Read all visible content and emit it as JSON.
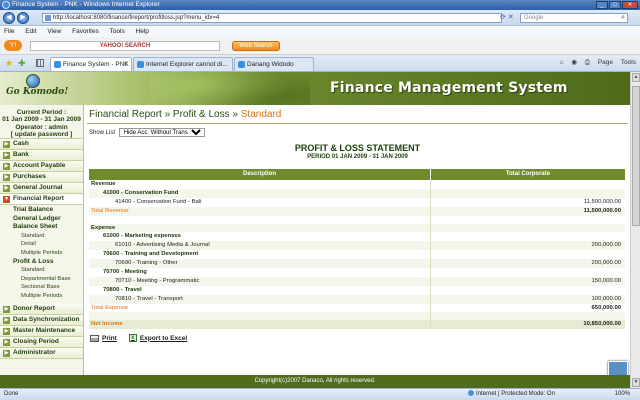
{
  "browser": {
    "window_title": "Finance System - PNK - Windows Internet Explorer",
    "url": "http://localhost:8080/finance/fireport/profitloss.jsp?menu_idx=4",
    "search_placeholder": "Google",
    "menu": [
      "File",
      "Edit",
      "View",
      "Favorites",
      "Tools",
      "Help"
    ],
    "yahoo_search_label": "YAHOO! SEARCH",
    "web_search_button": "Web Search",
    "tabs": [
      {
        "label": "Finance System - PNK"
      },
      {
        "label": "Internet Explorer cannot di..."
      },
      {
        "label": "Danang Widodo"
      }
    ],
    "toolbar_right": {
      "page": "Page",
      "tools": "Tools"
    },
    "status": {
      "zone": "Internet | Protected Mode: On",
      "zoom": "100%",
      "done": "Done"
    }
  },
  "app": {
    "logo_text": "Go Komodo!",
    "title": "Finance Management System",
    "footer": "Copyright(c)2007 Danaco, All rights reserved."
  },
  "sidebar": {
    "info": {
      "line1": "Current Period :",
      "line2": "01 Jan 2009 - 31 Jan 2009",
      "line3": "Operator : admin",
      "line4": "[ update password ]"
    },
    "items_top": [
      "Cash",
      "Bank",
      "Account Payable",
      "Purchases",
      "General Journal",
      "Financial Report"
    ],
    "sub": {
      "trial_balance": "Trial Balance",
      "general_ledger": "General Ledger",
      "balance_sheet": "Balance Sheet",
      "bs_standard": "Standard",
      "bs_detail": "Detail",
      "bs_multiple": "Multiple Periods",
      "profit_loss": "Profit & Loss",
      "pl_standard": "Standard",
      "pl_departmental": "Departmental Base",
      "pl_sectional": "Sectional Base",
      "pl_multiple": "Multiple Periods"
    },
    "items_bottom": [
      "Donor Report",
      "Data Synchronization",
      "Master Maintenance",
      "Closing Period",
      "Administrator"
    ]
  },
  "main": {
    "breadcrumb_base": "Financial Report » Profit & Loss » ",
    "breadcrumb_current": "Standard",
    "show_list_label": "Show List",
    "show_list_value": "Hide Acc. Without Transaction",
    "report_title": "PROFIT & LOSS STATEMENT",
    "report_period": "PERIOD 01 JAN 2009 - 31 JAN 2009",
    "columns": {
      "description": "Description",
      "total": "Total Corporate"
    },
    "rows": [
      {
        "kind": "section",
        "desc": "Revenue",
        "total": ""
      },
      {
        "kind": "group",
        "desc": "41000 - Conservation Fund",
        "total": ""
      },
      {
        "kind": "acct",
        "desc": "41400 - Conservation Fund - Bali",
        "total": "11,500,000.00"
      },
      {
        "kind": "total",
        "desc": "Total Revenue",
        "total": "11,500,000.00"
      },
      {
        "kind": "blank",
        "desc": "",
        "total": ""
      },
      {
        "kind": "section",
        "desc": "Expense",
        "total": ""
      },
      {
        "kind": "group",
        "desc": "61000 - Marketing expenses",
        "total": ""
      },
      {
        "kind": "acct",
        "desc": "61010 - Advertising Media & Journal",
        "total": "200,000.00"
      },
      {
        "kind": "group",
        "desc": "70600 - Training and Development",
        "total": ""
      },
      {
        "kind": "acct",
        "desc": "70690 - Training - Other",
        "total": "200,000.00"
      },
      {
        "kind": "group",
        "desc": "70700 - Meeting",
        "total": ""
      },
      {
        "kind": "acct",
        "desc": "70710 - Meeting - Programmatic",
        "total": "150,000.00"
      },
      {
        "kind": "group",
        "desc": "70800 - Travel",
        "total": ""
      },
      {
        "kind": "acct",
        "desc": "70810 - Travel - Transport",
        "total": "100,000.00"
      },
      {
        "kind": "total",
        "desc": "Total Expense",
        "total": "650,000.00"
      },
      {
        "kind": "blank",
        "desc": "",
        "total": ""
      },
      {
        "kind": "net",
        "desc": "Net Income",
        "total": "10,850,000.00"
      }
    ],
    "print_label": "Print",
    "export_label": "Export to Excel"
  }
}
